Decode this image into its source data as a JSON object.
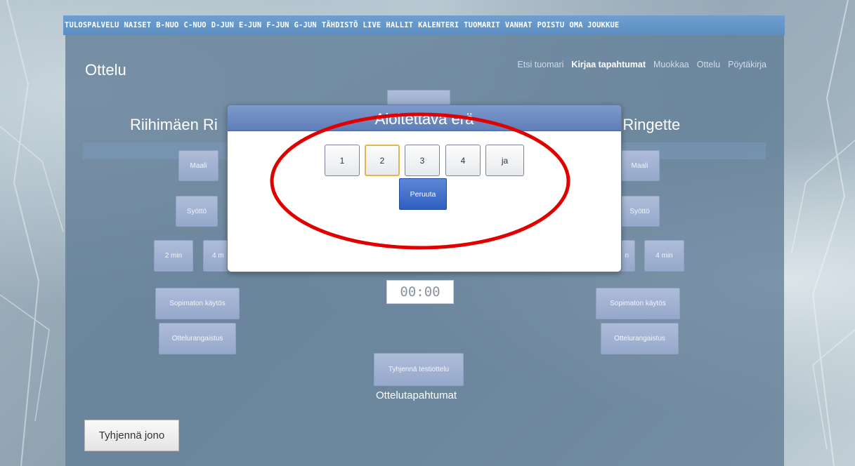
{
  "topnav": {
    "items": [
      "TULOSPALVELU",
      "NAISET",
      "B-NUO",
      "C-NUO",
      "D-JUN",
      "E-JUN",
      "F-JUN",
      "G-JUN",
      "TÄHDISTÖ",
      "LIVE",
      "HALLIT",
      "KALENTERI",
      "TUOMARIT",
      "VANHAT",
      "POISTU",
      "OMA JOUKKUE"
    ]
  },
  "page": {
    "title": "Ottelu"
  },
  "subnav": {
    "items": [
      "Etsi tuomari",
      "Kirjaa tapahtumat",
      "Muokkaa",
      "Ottelu",
      "Pöytäkirja"
    ],
    "active": "Kirjaa tapahtumat"
  },
  "teams": {
    "left_visible": "Riihimäen Ri",
    "right_visible": "n Ringette"
  },
  "left_controls": {
    "goal": "Maali",
    "assist": "Syöttö",
    "pen2": "2 min",
    "pen4": "4 m",
    "misconduct": "Sopimaton käytös",
    "match_penalty": "Ottelurangaistus"
  },
  "right_controls": {
    "goal": "Maali",
    "assist": "Syöttö",
    "pen2": "n",
    "pen4": "4 min",
    "misconduct": "Sopimaton käytös",
    "match_penalty": "Ottelurangaistus"
  },
  "center": {
    "clock": "00:00",
    "clear_test": "Tyhjennä testiottelu",
    "events_label": "Ottelutapahtumat"
  },
  "queue": {
    "clear_label": "Tyhjennä jono"
  },
  "modal": {
    "title": "Aloitettava erä",
    "periods": [
      "1",
      "2",
      "3",
      "4",
      "ja"
    ],
    "selected_period": "2",
    "cancel_label": "Peruuta"
  },
  "colors": {
    "nav": "#5b8ec2",
    "modal_header": "#6a87c0",
    "cancel_button": "#2f5fbe",
    "annotation": "#e00000"
  }
}
